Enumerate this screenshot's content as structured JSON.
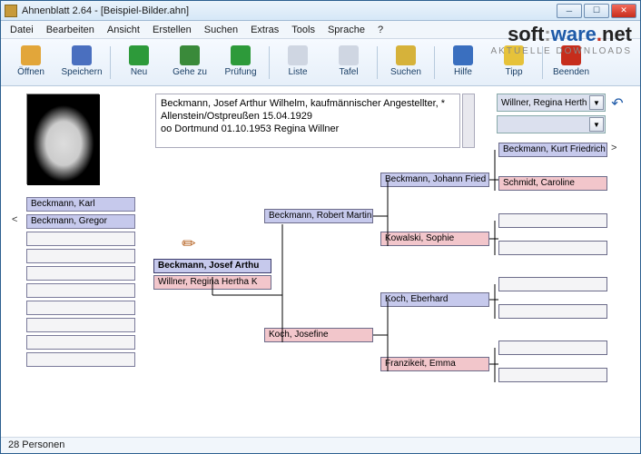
{
  "title": "Ahnenblatt 2.64 - [Beispiel-Bilder.ahn]",
  "menu": [
    "Datei",
    "Bearbeiten",
    "Ansicht",
    "Erstellen",
    "Suchen",
    "Extras",
    "Tools",
    "Sprache",
    "?"
  ],
  "logo": {
    "a": "soft",
    "b": ":",
    "c": "ware",
    "d": ".",
    "e": "net",
    "sub": "AKTUELLE DOWNLOADS"
  },
  "toolbar": [
    {
      "label": "Öffnen",
      "icon": "open"
    },
    {
      "label": "Speichern",
      "icon": "save"
    },
    {
      "sep": true
    },
    {
      "label": "Neu",
      "icon": "new"
    },
    {
      "label": "Gehe zu",
      "icon": "goto"
    },
    {
      "label": "Prüfung",
      "icon": "check"
    },
    {
      "sep": true
    },
    {
      "label": "Liste",
      "icon": "list"
    },
    {
      "label": "Tafel",
      "icon": "chart"
    },
    {
      "sep": true
    },
    {
      "label": "Suchen",
      "icon": "search"
    },
    {
      "sep": true
    },
    {
      "label": "Hilfe",
      "icon": "help"
    },
    {
      "label": "Tipp",
      "icon": "tip"
    },
    {
      "sep": true
    },
    {
      "label": "Beenden",
      "icon": "exit"
    }
  ],
  "info": {
    "l1": "Beckmann, Josef Arthur Wilhelm, kaufmännischer Angestellter, *",
    "l2": "Allenstein/Ostpreußen 15.04.1929",
    "l3": "oo Dortmund 01.10.1953 Regina Willner"
  },
  "history1": "Willner, Regina Herth",
  "siblings": [
    "Beckmann, Karl",
    "Beckmann, Gregor"
  ],
  "sel": {
    "husband": "Beckmann, Josef Arthu",
    "wife": "Willner, Regina Hertha K"
  },
  "gen2": {
    "father": "Beckmann, Robert Martin",
    "mother": "Koch, Josefine"
  },
  "gen3": {
    "pp": "Beckmann, Johann Fried",
    "pm": "Kowalski, Sophie",
    "mp": "Koch, Eberhard",
    "mm": "Franzikeit, Emma"
  },
  "gen4": {
    "ppp": "Beckmann, Kurt Friedrich",
    "ppm": "Schmidt, Caroline"
  },
  "status": "28 Personen"
}
